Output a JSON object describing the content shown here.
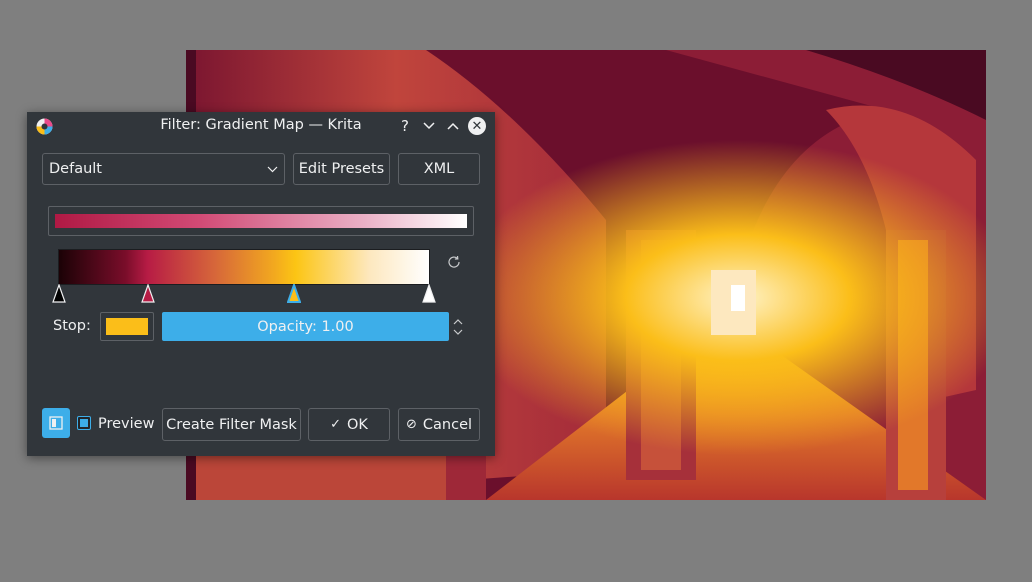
{
  "window": {
    "title": "Filter: Gradient Map — Krita",
    "help_glyph": "?",
    "minimize_glyph": "⌄",
    "maximize_glyph": "⌃",
    "close_glyph": "✕"
  },
  "presets": {
    "selected": "Default",
    "edit_label": "Edit Presets",
    "xml_label": "XML"
  },
  "gradient": {
    "stops": [
      {
        "position": 0.0,
        "color": "#000000"
      },
      {
        "position": 0.24,
        "color": "#b71c45"
      },
      {
        "position": 0.635,
        "color": "#fbbe19"
      },
      {
        "position": 1.0,
        "color": "#ffffff"
      }
    ],
    "selected_stop_index": 2
  },
  "stop": {
    "label": "Stop:",
    "color": "#fbbe19",
    "opacity_label": "Opacity: 1.00"
  },
  "footer": {
    "preview_label": "Preview",
    "preview_checked": true,
    "create_mask_label": "Create Filter Mask",
    "ok_label": "OK",
    "cancel_label": "Cancel"
  },
  "colors": {
    "accent": "#3daee9",
    "dialog_bg": "#31363b",
    "text": "#eff0f1"
  }
}
